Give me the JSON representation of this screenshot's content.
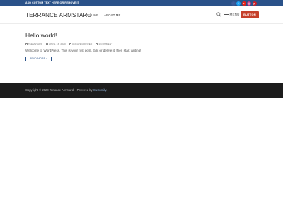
{
  "topbar": {
    "text": "ADD CUSTOM TEXT HERE OR REMOVE IT",
    "socials": [
      {
        "icon": "facebook-icon",
        "glyph": "f"
      },
      {
        "icon": "twitter-icon",
        "glyph": "t"
      },
      {
        "icon": "youtube-icon",
        "glyph": "▶"
      },
      {
        "icon": "instagram-icon",
        "glyph": "◎"
      },
      {
        "icon": "pinterest-icon",
        "glyph": "p"
      }
    ],
    "background": "#2a5289"
  },
  "header": {
    "brand": "TERRANCE ARMSTARD",
    "nav": [
      {
        "label": "RESUME"
      },
      {
        "label": "ABOUT ME"
      }
    ],
    "menu_label": "MENU",
    "button_label": "BUTTON",
    "button_color": "#c5402b"
  },
  "post": {
    "title": "Hello world!",
    "meta": {
      "author": "TAEMSTARD",
      "date": "APRIL 13, 2020",
      "category": "UNCATEGORIZED",
      "comments": "1 COMMENT"
    },
    "excerpt": "Welcome to WordPress. This is your first post. Edit or delete it, then start writing!",
    "read_more": "READ MORE »"
  },
  "footer": {
    "text": "Copyright © 2020 Terrance Armstard – Powered by",
    "link": "Customify",
    "suffix": "."
  }
}
